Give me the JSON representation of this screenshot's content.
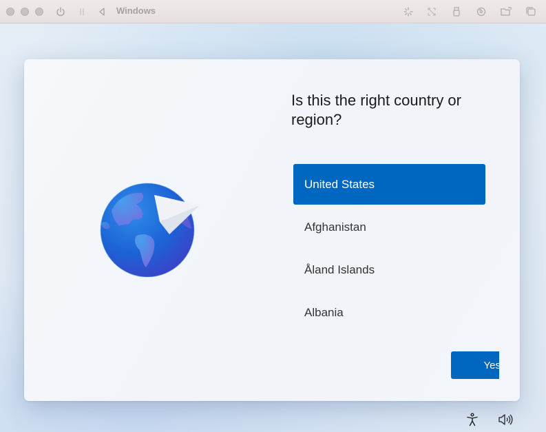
{
  "window": {
    "title": "Windows"
  },
  "setup": {
    "heading": "Is this the right country or region?",
    "countries": [
      {
        "label": "United States",
        "selected": true
      },
      {
        "label": "Afghanistan",
        "selected": false
      },
      {
        "label": "Åland Islands",
        "selected": false
      },
      {
        "label": "Albania",
        "selected": false
      }
    ],
    "yes_label": "Yes"
  },
  "icons": {
    "titlebar": [
      "power-icon",
      "pause-icon",
      "back-icon",
      "spinner-icon",
      "fullscreen-icon",
      "usb-icon",
      "disc-icon",
      "shared-folder-icon",
      "window-icon"
    ],
    "bottom": [
      "accessibility-icon",
      "volume-icon"
    ]
  },
  "colors": {
    "accent": "#0067c0",
    "heading_text": "#1b1b1b"
  }
}
